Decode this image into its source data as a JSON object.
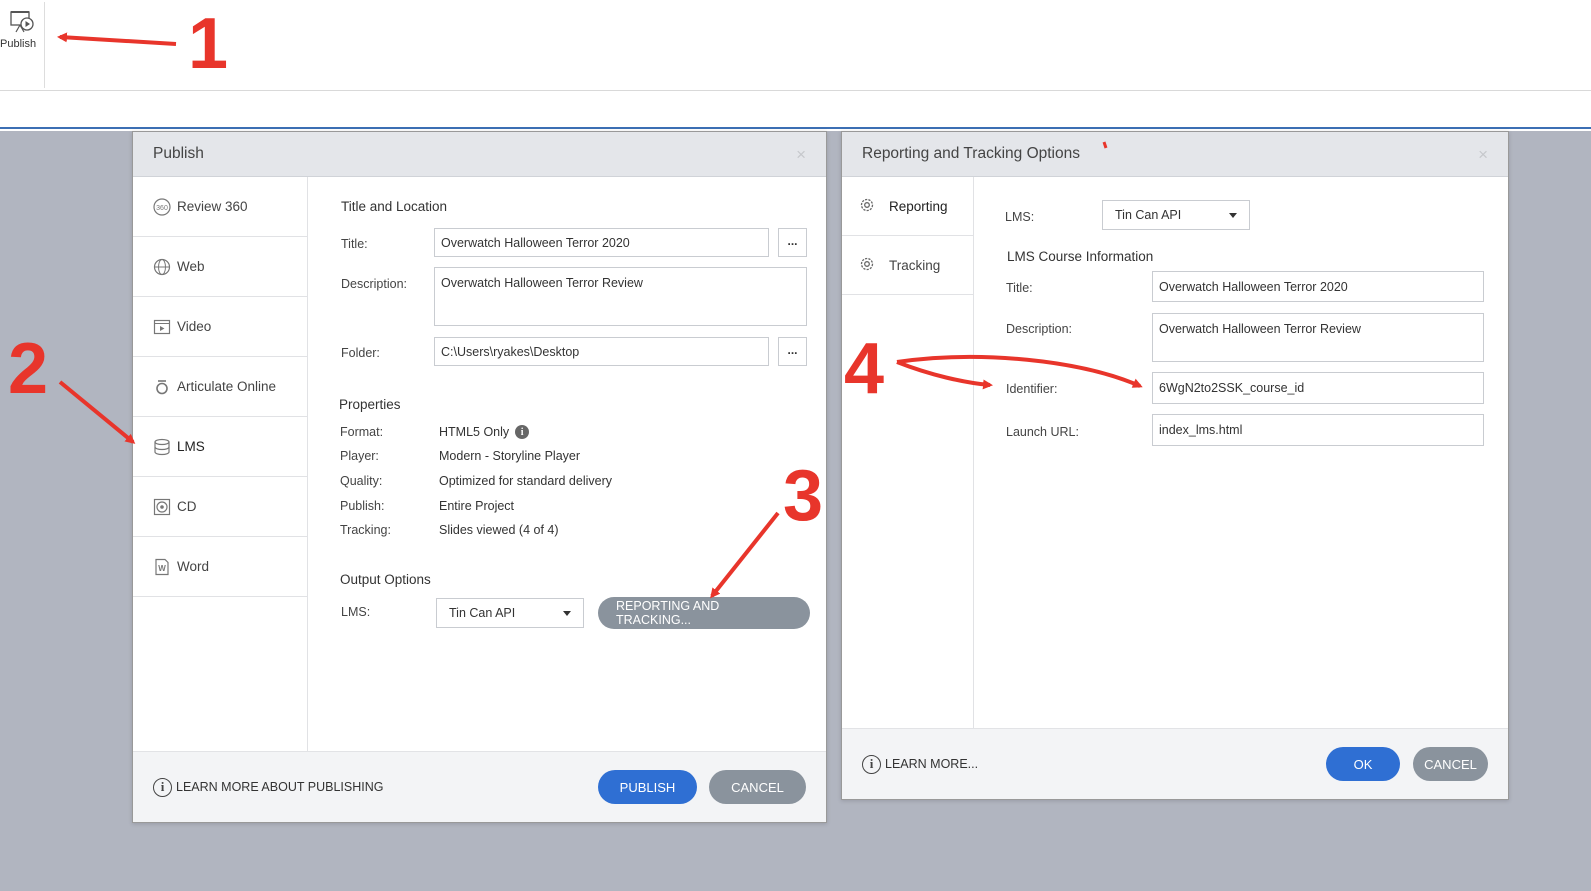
{
  "ribbon": {
    "publish_label": "Publish"
  },
  "publish_dialog": {
    "title": "Publish",
    "close": "×",
    "sidebar": [
      {
        "label": "Review 360",
        "icon": "review-360-icon"
      },
      {
        "label": "Web",
        "icon": "globe-icon"
      },
      {
        "label": "Video",
        "icon": "video-icon"
      },
      {
        "label": "Articulate Online",
        "icon": "articulate-online-icon"
      },
      {
        "label": "LMS",
        "icon": "database-icon",
        "active": true
      },
      {
        "label": "CD",
        "icon": "cd-icon"
      },
      {
        "label": "Word",
        "icon": "word-icon"
      }
    ],
    "title_location": {
      "heading": "Title and Location",
      "title_label": "Title:",
      "title_value": "Overwatch Halloween Terror 2020",
      "description_label": "Description:",
      "description_value": "Overwatch Halloween Terror Review",
      "folder_label": "Folder:",
      "folder_value": "C:\\Users\\ryakes\\Desktop",
      "browse": "..."
    },
    "properties": {
      "heading": "Properties",
      "rows": [
        {
          "label": "Format:",
          "value": "HTML5 Only"
        },
        {
          "label": "Player:",
          "value": "Modern - Storyline Player"
        },
        {
          "label": "Quality:",
          "value": "Optimized for standard delivery"
        },
        {
          "label": "Publish:",
          "value": "Entire Project"
        },
        {
          "label": "Tracking:",
          "value": "Slides viewed (4 of 4)"
        }
      ]
    },
    "output": {
      "heading": "Output Options",
      "lms_label": "LMS:",
      "lms_value": "Tin Can API",
      "reporting_button": "REPORTING AND TRACKING..."
    },
    "footer": {
      "learn_more": "LEARN MORE ABOUT PUBLISHING",
      "publish": "PUBLISH",
      "cancel": "CANCEL"
    }
  },
  "report_dialog": {
    "title": "Reporting and Tracking Options",
    "close": "×",
    "sidebar": [
      {
        "label": "Reporting",
        "icon": "gear-icon",
        "active": true
      },
      {
        "label": "Tracking",
        "icon": "gear-icon"
      }
    ],
    "lms_label": "LMS:",
    "lms_value": "Tin Can API",
    "course_info_heading": "LMS Course Information",
    "title_label": "Title:",
    "title_value": "Overwatch Halloween Terror 2020",
    "description_label": "Description:",
    "description_value": "Overwatch Halloween Terror Review",
    "identifier_label": "Identifier:",
    "identifier_value": "6WgN2to2SSK_course_id",
    "launch_label": "Launch URL:",
    "launch_value": "index_lms.html",
    "footer": {
      "learn_more": "LEARN MORE...",
      "ok": "OK",
      "cancel": "CANCEL"
    }
  },
  "annotations": {
    "n1": "1",
    "n2": "2",
    "n3": "3",
    "n4": "4",
    "color": "#e8352b"
  },
  "colors": {
    "primary_button": "#2f6fd3",
    "secondary_button": "#8a939d",
    "backdrop": "#b1b5c0"
  }
}
